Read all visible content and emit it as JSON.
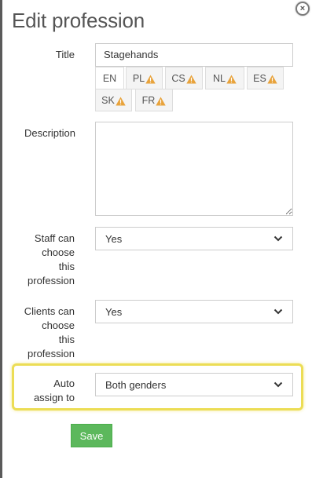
{
  "dialog": {
    "title": "Edit profession",
    "close_glyph": "×"
  },
  "title_field": {
    "label": "Title",
    "value": "Stagehands"
  },
  "language_tabs": [
    {
      "code": "EN",
      "warning": false,
      "active": true
    },
    {
      "code": "PL",
      "warning": true,
      "active": false
    },
    {
      "code": "CS",
      "warning": true,
      "active": false
    },
    {
      "code": "NL",
      "warning": true,
      "active": false
    },
    {
      "code": "ES",
      "warning": true,
      "active": false
    },
    {
      "code": "SK",
      "warning": true,
      "active": false
    },
    {
      "code": "FR",
      "warning": true,
      "active": false
    }
  ],
  "description_field": {
    "label": "Description",
    "value": ""
  },
  "staff_choose": {
    "label_lines": [
      "Staff can",
      "choose",
      "this",
      "profession"
    ],
    "value": "Yes"
  },
  "clients_choose": {
    "label_lines": [
      "Clients can",
      "choose",
      "this",
      "profession"
    ],
    "value": "Yes"
  },
  "auto_assign": {
    "label_lines": [
      "Auto",
      "assign to"
    ],
    "value": "Both genders",
    "highlighted": true
  },
  "save_label": "Save",
  "colors": {
    "save_button": "#5cb85c",
    "highlight": "#ecdd55",
    "warning": "#e8a33c"
  },
  "icons": {
    "close": "close-circle-icon",
    "warning": "warning-triangle-icon",
    "dropdown": "chevron-down-icon"
  }
}
